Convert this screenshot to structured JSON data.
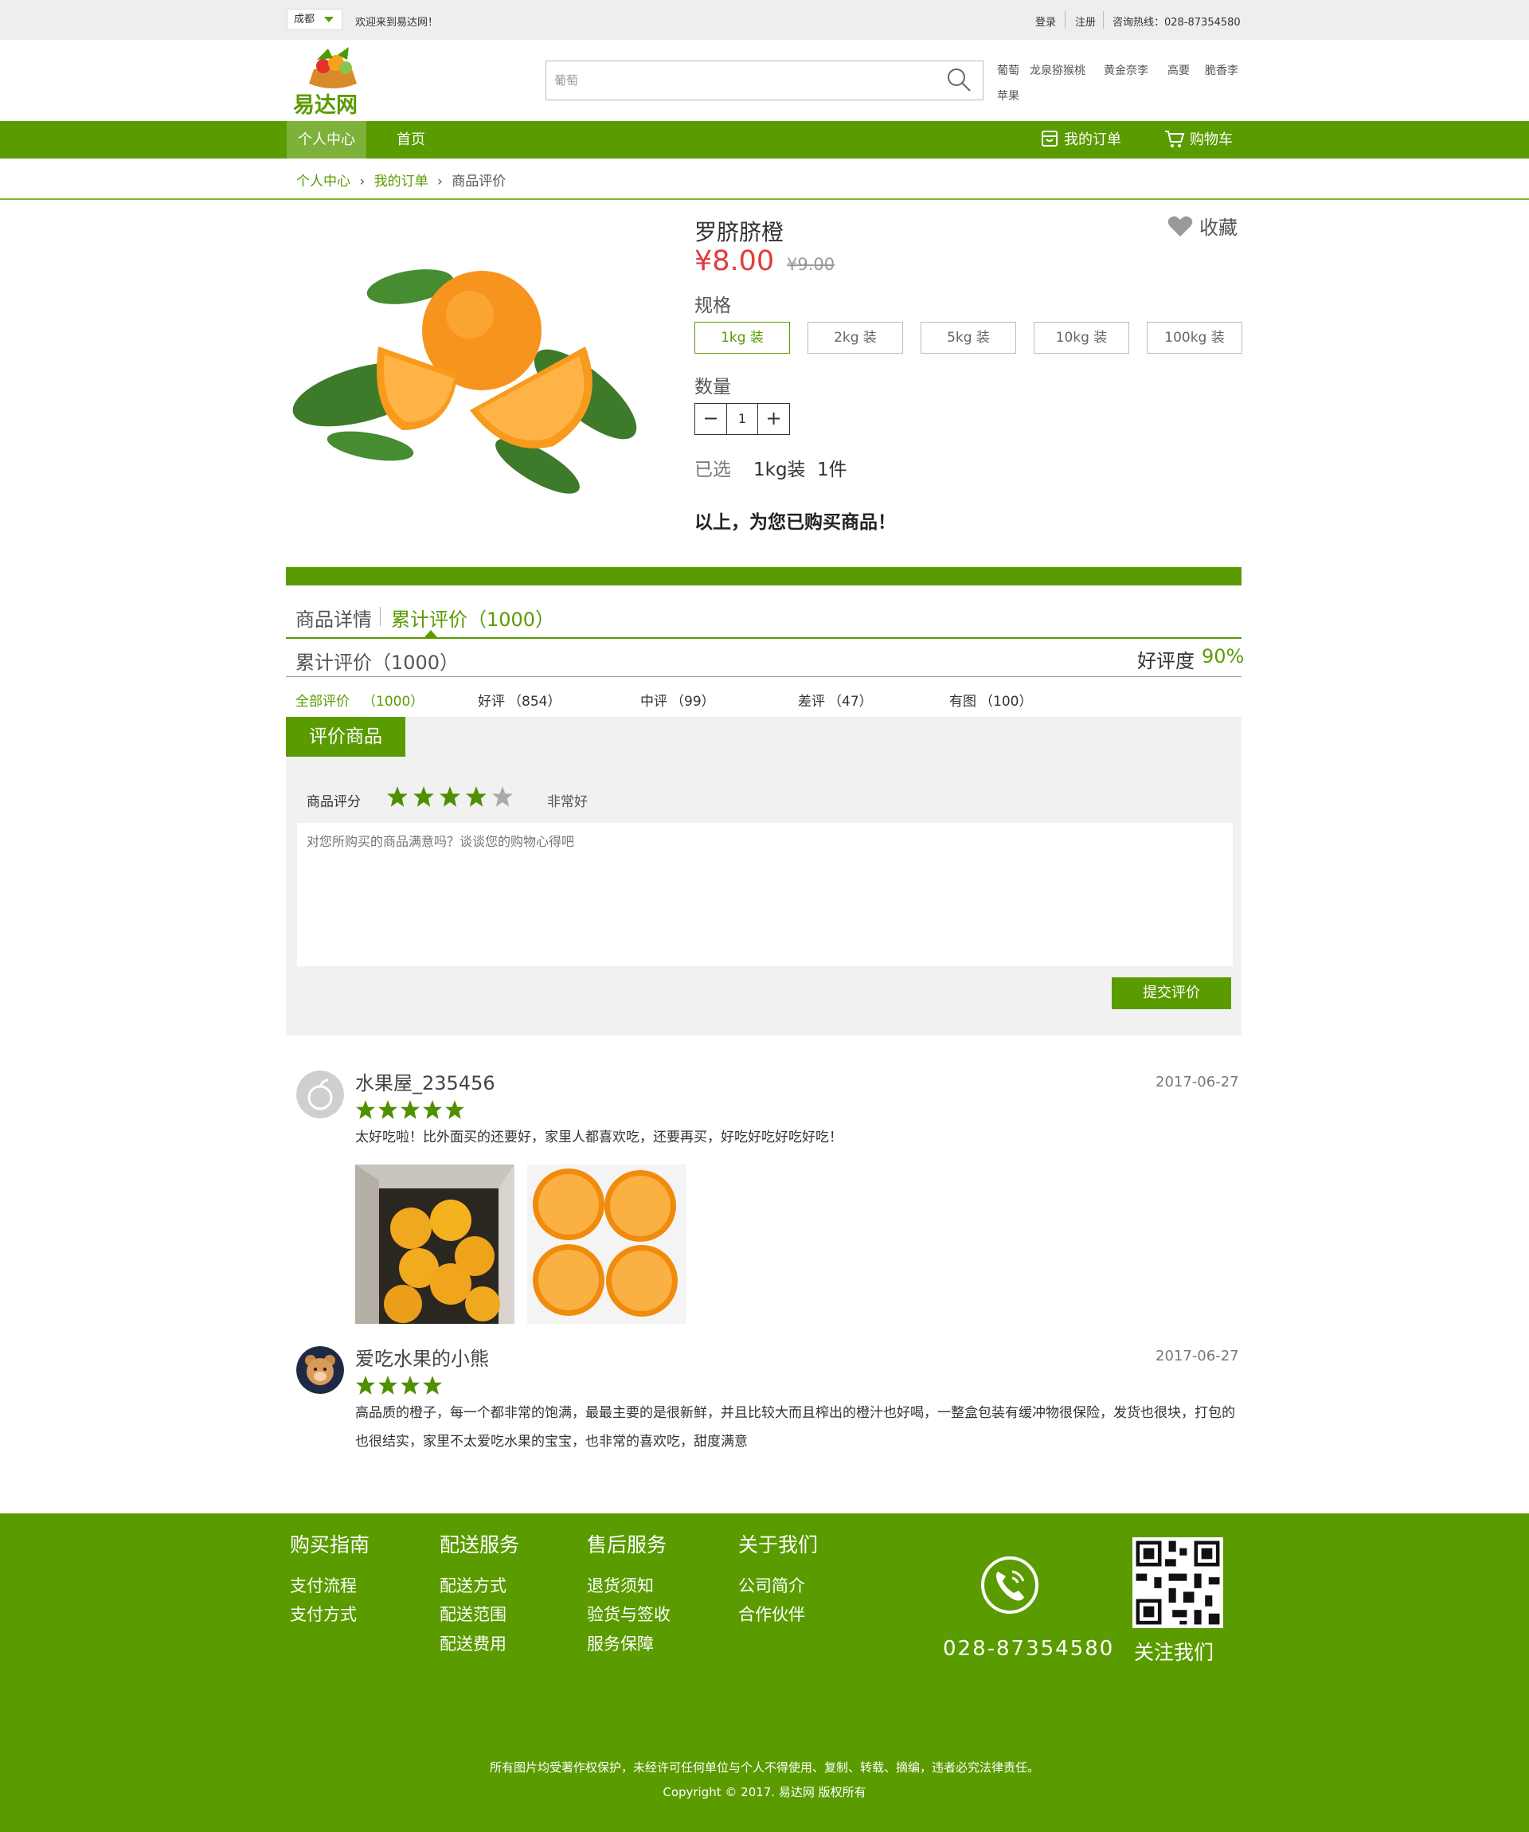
{
  "topbar": {
    "city": "成都",
    "welcome": "欢迎来到易达网！",
    "login": "登录",
    "register": "注册",
    "hotline": "咨询热线：028-87354580"
  },
  "header": {
    "logo_text": "易达网",
    "search_placeholder": "葡萄",
    "hot_words": [
      "葡萄",
      "龙泉猕猴桃",
      "黄金奈李",
      "高要",
      "脆香李",
      "苹果"
    ]
  },
  "nav": {
    "personal": "个人中心",
    "home": "首页",
    "orders": "我的订单",
    "cart": "购物车"
  },
  "breadcrumb": [
    "个人中心",
    "我的订单",
    "商品评价"
  ],
  "product": {
    "name": "罗脐脐橙",
    "favorite": "收藏",
    "price": "¥8.00",
    "old_price": "¥9.00",
    "spec_label": "规格",
    "specs": [
      "1kg 装",
      "2kg 装",
      "5kg 装",
      "10kg 装",
      "100kg 装"
    ],
    "selected_spec_index": 0,
    "qty_label": "数量",
    "qty": "1",
    "selected_label": "已选",
    "selected_spec": "1kg装",
    "selected_qty": "1件",
    "purchased_note": "以上，为您已购买商品！"
  },
  "tabs": {
    "details": "商品详情",
    "reviews": "累计评价（1000）",
    "cumulative": "累计评价（1000）",
    "rating_label": "好评度",
    "rating_value": "90%"
  },
  "filters": [
    {
      "label": "全部评价",
      "count": "（1000）"
    },
    {
      "label": "好评",
      "count": "（854）"
    },
    {
      "label": "中评",
      "count": "（99）"
    },
    {
      "label": "差评",
      "count": "（47）"
    },
    {
      "label": "有图",
      "count": "（100）"
    }
  ],
  "review_form": {
    "title": "评价商品",
    "score_label": "商品评分",
    "score": 4,
    "score_max": 5,
    "score_text": "非常好",
    "placeholder": "对您所购买的商品满意吗？谈谈您的购物心得吧",
    "submit": "提交评价"
  },
  "reviews": [
    {
      "user": "水果屋_235456",
      "date": "2017-06-27",
      "stars": 5,
      "text": "太好吃啦！比外面买的还要好，家里人都喜欢吃，还要再买，好吃好吃好吃好吃！",
      "photos": [
        "orange-box-photo",
        "cut-orange-photo"
      ]
    },
    {
      "user": "爱吃水果的小熊",
      "date": "2017-06-27",
      "stars": 4,
      "text": "高品质的橙子，每一个都非常的饱满，最最主要的是很新鲜，并且比较大而且榨出的橙汁也好喝，一整盒包装有缓冲物很保险，发货也很块，打包的也很结实，家里不太爱吃水果的宝宝，也非常的喜欢吃，甜度满意"
    }
  ],
  "footer": {
    "columns": [
      {
        "title": "购买指南",
        "links": [
          "支付流程",
          "支付方式"
        ]
      },
      {
        "title": "配送服务",
        "links": [
          "配送方式",
          "配送范围",
          "配送费用"
        ]
      },
      {
        "title": "售后服务",
        "links": [
          "退货须知",
          "验货与签收",
          "服务保障"
        ]
      },
      {
        "title": "关于我们",
        "links": [
          "公司简介",
          "合作伙伴"
        ]
      }
    ],
    "phone": "028-87354580",
    "follow": "关注我们",
    "copyright_notice": "所有图片均受著作权保护，未经许可任何单位与个人不得使用、复制、转载、摘编，违者必究法律责任。",
    "copyright": "Copyright © 2017. 易达网 版权所有"
  },
  "colors": {
    "brand_green": "#5a9b00",
    "price_red": "#e4393c",
    "star_green": "#4f8f00",
    "star_gray": "#aaaaaa"
  }
}
